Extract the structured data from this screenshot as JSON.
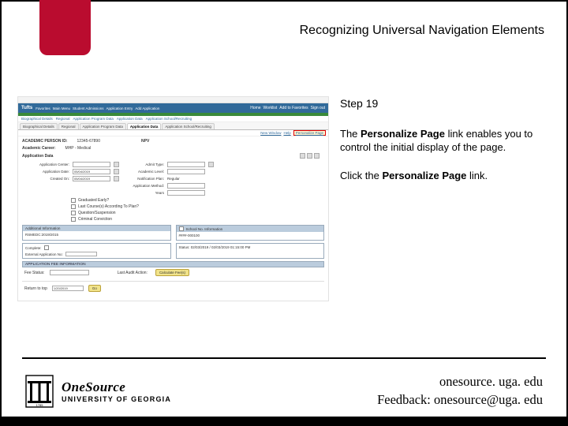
{
  "title": "Recognizing Universal Navigation Elements",
  "side": {
    "step": "Step 19",
    "para1_a": "The ",
    "para1_b": "Personalize Page",
    "para1_c": " link enables you to control the initial display of the page.",
    "para2_a": "Click the ",
    "para2_b": "Personalize Page",
    "para2_c": " link."
  },
  "screenshot": {
    "brand": "Tufts",
    "topnav": [
      "Favorites",
      "Main Menu",
      "Student Admissions",
      "Application Entry",
      "Add Application"
    ],
    "topnav_right": [
      "Home",
      "Worklist",
      "Add to Favorites",
      "Sign out"
    ],
    "breadcrumb": [
      "Biographical Details",
      "Regional",
      "Application Program Data",
      "Application Data",
      "Application School/Recruiting"
    ],
    "subtabs": [
      "Biographical Details",
      "Regional",
      "Application Program Data",
      "Application Data",
      "Application School/Recruiting"
    ],
    "active_tab": "Application Data",
    "toolbar": {
      "new_window": "New Window",
      "help": "Help",
      "personalize": "Personalize Page"
    },
    "head": {
      "id_label": "ACADEMIC PERSON ID:",
      "id_value": "12345-67890",
      "name_label": "NPV"
    },
    "head2": {
      "lbl": "Academic Career:",
      "val": "MHP - Medical"
    },
    "date_row": {
      "lbl": "Application Data"
    },
    "form": {
      "r1": {
        "l1": "Application Center:",
        "l2": "Admit Type:"
      },
      "r2": {
        "l1": "Application Date:",
        "v1": "05/04/2019",
        "l2": "Academic Level:"
      },
      "r3": {
        "l1": "Created On:",
        "v1": "05/04/2019",
        "l2": "Notification Plan:",
        "v2": "Regular"
      },
      "r4": {
        "l2": "Application Method:"
      },
      "r5": {
        "l2": "Years"
      }
    },
    "checks": {
      "c1": "Graduated Early?",
      "c2": "Last Course(s) According To Plan?",
      "c3": "Question/Suspension",
      "c4": "Criminal Conviction"
    },
    "panels": {
      "left1_title": "Additional Information",
      "left1_body": "RSMEDC:2019/2015",
      "right1_title": "School No. Information",
      "right1_body": "####-000100",
      "left2_l1": "Complete:",
      "left2_l2": "External Application No:",
      "right2_l": "Status:",
      "right2_vals": "02/03/2019 / 02/03/2019 01:15:00 PM"
    },
    "fee": {
      "title": "APPLICATION FEE INFORMATION",
      "l1": "Fee Status:",
      "l2": "Last Audit Action:",
      "btn": "Calculate Fee(s)"
    },
    "bottom": {
      "lbl": "Return to top",
      "date": "1/20/2019",
      "go": "Go"
    }
  },
  "footer": {
    "brand_one": "OneSource",
    "brand_univ": "UNIVERSITY OF GEORGIA",
    "url": "onesource. uga. edu",
    "feedback": "Feedback: onesource@uga. edu"
  }
}
